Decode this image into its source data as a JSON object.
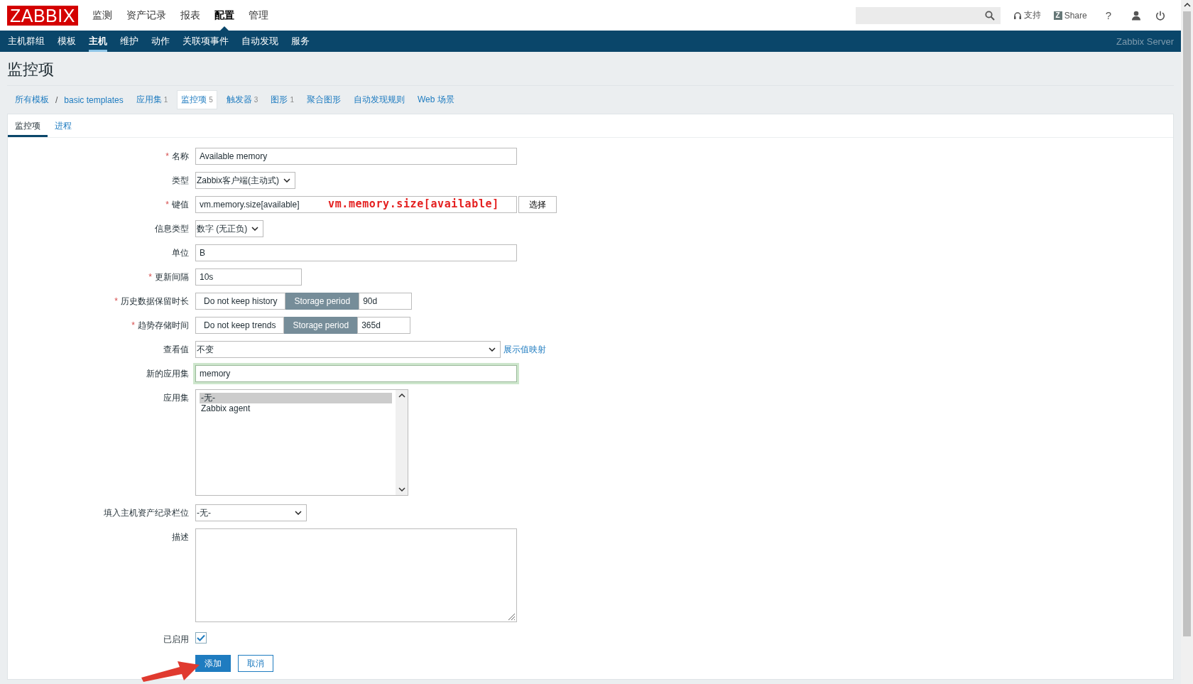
{
  "header": {
    "logo": "ZABBIX",
    "menu": [
      {
        "label": "监测",
        "selected": false
      },
      {
        "label": "资产记录",
        "selected": false
      },
      {
        "label": "报表",
        "selected": false
      },
      {
        "label": "配置",
        "selected": true
      },
      {
        "label": "管理",
        "selected": false
      }
    ],
    "support": "支持",
    "share_icon": "Z",
    "share": "Share",
    "help": "?"
  },
  "subnav": {
    "items": [
      {
        "label": "主机群组",
        "selected": false
      },
      {
        "label": "模板",
        "selected": false
      },
      {
        "label": "主机",
        "selected": true
      },
      {
        "label": "维护",
        "selected": false
      },
      {
        "label": "动作",
        "selected": false
      },
      {
        "label": "关联项事件",
        "selected": false
      },
      {
        "label": "自动发现",
        "selected": false
      },
      {
        "label": "服务",
        "selected": false
      }
    ],
    "server": "Zabbix Server"
  },
  "page_title": "监控项",
  "breadcrumbs": [
    "所有模板",
    "basic templates"
  ],
  "breadcrumb_separator": "/",
  "tabs": [
    {
      "label": "应用集",
      "count": "1",
      "selected": false
    },
    {
      "label": "监控项",
      "count": "5",
      "selected": true
    },
    {
      "label": "触发器",
      "count": "3",
      "selected": false
    },
    {
      "label": "图形",
      "count": "1",
      "selected": false
    },
    {
      "label": "聚合图形",
      "selected": false
    },
    {
      "label": "自动发现规则",
      "selected": false
    },
    {
      "label": "Web 场景",
      "selected": false
    }
  ],
  "form_tabs": [
    {
      "label": "监控项",
      "selected": true
    },
    {
      "label": "进程",
      "selected": false
    }
  ],
  "required_mark": "*",
  "fields": [
    {
      "kind": "text",
      "label": "名称",
      "required": true,
      "value": "Available memory"
    },
    {
      "kind": "select",
      "label": "类型",
      "required": false,
      "value": "Zabbix客户端(主动式)"
    },
    {
      "kind": "key",
      "label": "键值",
      "required": true,
      "value": "vm.memory.size[available]",
      "button": "选择",
      "annotation": "vm.memory.size[available]"
    },
    {
      "kind": "select",
      "label": "信息类型",
      "required": false,
      "value": "数字 (无正负)"
    },
    {
      "kind": "text",
      "label": "单位",
      "required": false,
      "value": "B"
    },
    {
      "kind": "text",
      "label": "更新间隔",
      "required": true,
      "value": "10s"
    },
    {
      "kind": "segmented",
      "label": "历史数据保留时长",
      "required": true,
      "options": [
        {
          "label": "Do not keep history",
          "selected": false
        },
        {
          "label": "Storage period",
          "selected": true
        }
      ],
      "value": "90d"
    },
    {
      "kind": "segmented",
      "label": "趋势存储时间",
      "required": true,
      "options": [
        {
          "label": "Do not keep trends",
          "selected": false
        },
        {
          "label": "Storage period",
          "selected": true
        }
      ],
      "value": "365d"
    },
    {
      "kind": "select",
      "label": "查看值",
      "required": false,
      "value": "不变",
      "link": "展示值映射"
    },
    {
      "kind": "text",
      "label": "新的应用集",
      "required": false,
      "value": "memory",
      "focused": true
    },
    {
      "kind": "listbox",
      "label": "应用集",
      "required": false,
      "items": [
        {
          "label": "-无-",
          "selected": true
        },
        {
          "label": "Zabbix agent",
          "selected": false
        }
      ]
    },
    {
      "kind": "select",
      "label": "填入主机资产纪录栏位",
      "required": false,
      "value": "-无-"
    },
    {
      "kind": "textarea",
      "label": "描述",
      "required": false
    },
    {
      "kind": "checkbox",
      "label": "已启用",
      "required": false,
      "checked": true
    }
  ],
  "buttons": [
    {
      "label": "添加",
      "kind": "primary"
    },
    {
      "label": "取消",
      "kind": "secondary"
    }
  ]
}
